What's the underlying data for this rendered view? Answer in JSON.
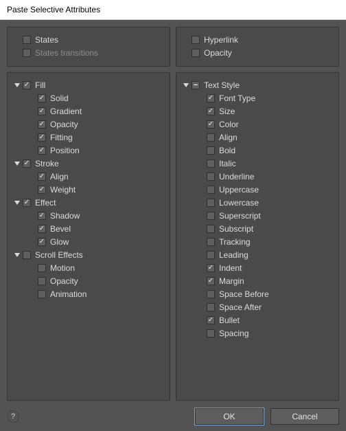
{
  "title": "Paste Selective Attributes",
  "topLeft": {
    "states": {
      "label": "States",
      "checked": false,
      "disabled": false
    },
    "transitions": {
      "label": "States transitions",
      "checked": false,
      "disabled": true
    }
  },
  "topRight": {
    "hyperlink": {
      "label": "Hyperlink",
      "checked": false
    },
    "opacity": {
      "label": "Opacity",
      "checked": false
    }
  },
  "left": [
    {
      "label": "Fill",
      "checked": true,
      "expanded": true,
      "hasDisclosure": true,
      "children": [
        {
          "label": "Solid",
          "checked": true
        },
        {
          "label": "Gradient",
          "checked": true
        },
        {
          "label": "Opacity",
          "checked": true
        },
        {
          "label": "Fitting",
          "checked": true
        },
        {
          "label": "Position",
          "checked": true
        }
      ]
    },
    {
      "label": "Stroke",
      "checked": true,
      "expanded": true,
      "hasDisclosure": true,
      "children": [
        {
          "label": "Align",
          "checked": true
        },
        {
          "label": "Weight",
          "checked": true
        }
      ]
    },
    {
      "label": "Effect",
      "checked": true,
      "expanded": true,
      "hasDisclosure": true,
      "children": [
        {
          "label": "Shadow",
          "checked": true
        },
        {
          "label": "Bevel",
          "checked": true
        },
        {
          "label": "Glow",
          "checked": true
        }
      ]
    },
    {
      "label": "Scroll Effects",
      "checked": false,
      "expanded": true,
      "hasDisclosure": true,
      "children": [
        {
          "label": "Motion",
          "checked": false
        },
        {
          "label": "Opacity",
          "checked": false
        },
        {
          "label": "Animation",
          "checked": false
        }
      ]
    }
  ],
  "right": [
    {
      "label": "Text Style",
      "checked": "minus",
      "expanded": true,
      "hasDisclosure": true,
      "children": [
        {
          "label": "Font Type",
          "checked": true
        },
        {
          "label": "Size",
          "checked": true
        },
        {
          "label": "Color",
          "checked": true
        },
        {
          "label": "Align",
          "checked": false
        },
        {
          "label": "Bold",
          "checked": false
        },
        {
          "label": "Italic",
          "checked": false
        },
        {
          "label": "Underline",
          "checked": false
        },
        {
          "label": "Uppercase",
          "checked": false
        },
        {
          "label": "Lowercase",
          "checked": false
        },
        {
          "label": "Superscript",
          "checked": false
        },
        {
          "label": "Subscript",
          "checked": false
        },
        {
          "label": "Tracking",
          "checked": false
        },
        {
          "label": "Leading",
          "checked": false
        },
        {
          "label": "Indent",
          "checked": true
        },
        {
          "label": "Margin",
          "checked": true
        },
        {
          "label": "Space Before",
          "checked": false
        },
        {
          "label": "Space After",
          "checked": false
        },
        {
          "label": "Bullet",
          "checked": true
        },
        {
          "label": "Spacing",
          "checked": false
        }
      ]
    }
  ],
  "buttons": {
    "ok": "OK",
    "cancel": "Cancel"
  },
  "help_glyph": "?"
}
